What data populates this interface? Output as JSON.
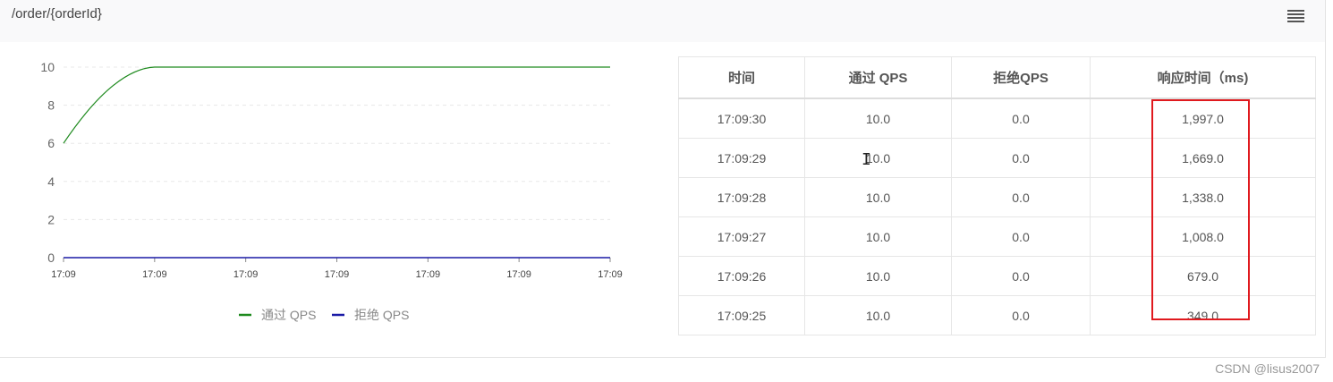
{
  "panel": {
    "title": "/order/{orderId}",
    "menu_icon": "hamburger-menu-icon"
  },
  "chart_data": {
    "type": "line",
    "x": [
      "17:09",
      "17:09",
      "17:09",
      "17:09",
      "17:09",
      "17:09",
      "17:09"
    ],
    "ylim": [
      0,
      10
    ],
    "yticks": [
      0,
      2,
      4,
      6,
      8,
      10
    ],
    "grid": true,
    "legend_position": "bottom",
    "series": [
      {
        "name": "通过 QPS",
        "color": "#1e8a1e",
        "values": [
          6,
          10,
          10,
          10,
          10,
          10,
          10
        ]
      },
      {
        "name": "拒绝 QPS",
        "color": "#1a1aa6",
        "values": [
          0,
          0,
          0,
          0,
          0,
          0,
          0
        ]
      }
    ]
  },
  "table": {
    "headers": [
      "时间",
      "通过 QPS",
      "拒绝QPS",
      "响应时间（ms)"
    ],
    "rows": [
      [
        "17:09:30",
        "10.0",
        "0.0",
        "1,997.0"
      ],
      [
        "17:09:29",
        "10.0",
        "0.0",
        "1,669.0"
      ],
      [
        "17:09:28",
        "10.0",
        "0.0",
        "1,338.0"
      ],
      [
        "17:09:27",
        "10.0",
        "0.0",
        "1,008.0"
      ],
      [
        "17:09:26",
        "10.0",
        "0.0",
        "679.0"
      ],
      [
        "17:09:25",
        "10.0",
        "0.0",
        "349.0"
      ]
    ]
  },
  "colors": {
    "highlight": "#e0191e"
  },
  "watermark": "CSDN @lisus2007"
}
